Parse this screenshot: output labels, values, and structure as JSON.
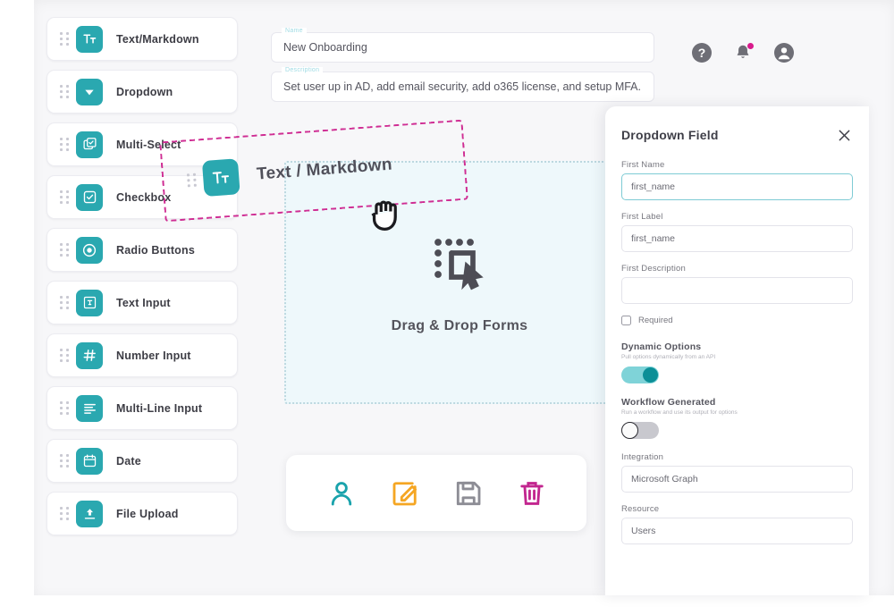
{
  "header": {
    "name_field": {
      "legend": "Name",
      "value": "New Onboarding"
    },
    "description_field": {
      "legend": "Description",
      "value": "Set user up in AD, add email security, add o365 license, and setup MFA."
    },
    "icons": [
      {
        "name": "help-icon",
        "label": "Help"
      },
      {
        "name": "notifications-bell-icon",
        "label": "Notifications"
      },
      {
        "name": "account-avatar-icon",
        "label": "Account"
      }
    ]
  },
  "palette": {
    "items": [
      {
        "label": "Text/Markdown",
        "icon": "text-markdown-icon"
      },
      {
        "label": "Dropdown",
        "icon": "dropdown-icon"
      },
      {
        "label": "Multi-Select",
        "icon": "multi-select-icon"
      },
      {
        "label": "Checkbox",
        "icon": "checkbox-icon"
      },
      {
        "label": "Radio Buttons",
        "icon": "radio-buttons-icon"
      },
      {
        "label": "Text Input",
        "icon": "text-input-icon"
      },
      {
        "label": "Number Input",
        "icon": "number-input-icon"
      },
      {
        "label": "Multi-Line Input",
        "icon": "multi-line-input-icon"
      },
      {
        "label": "Date",
        "icon": "date-icon"
      },
      {
        "label": "File Upload",
        "icon": "file-upload-icon"
      }
    ]
  },
  "canvas": {
    "dropzone_label": "Drag & Drop Forms",
    "dragging_item": {
      "label": "Text / Markdown",
      "icon": "text-markdown-icon"
    }
  },
  "actionbar": {
    "items": [
      {
        "name": "user-icon",
        "label": "User",
        "color": "#1aa3ac"
      },
      {
        "name": "edit-icon",
        "label": "Edit",
        "color": "#f5a623"
      },
      {
        "name": "save-icon",
        "label": "Save",
        "color": "#8d8d95"
      },
      {
        "name": "delete-icon",
        "label": "Delete",
        "color": "#c2268f"
      }
    ]
  },
  "properties": {
    "title": "Dropdown Field",
    "close_label": "Close",
    "fields": [
      {
        "label": "First Name",
        "value": "first_name",
        "focused": true
      },
      {
        "label": "First Label",
        "value": "first_name",
        "focused": false
      },
      {
        "label": "First Description",
        "value": "",
        "focused": false
      }
    ],
    "required": {
      "label": "Required",
      "checked": false
    },
    "toggles": [
      {
        "title": "Dynamic Options",
        "subtitle": "Pull options dynamically from an API",
        "state": "on"
      },
      {
        "title": "Workflow Generated",
        "subtitle": "Run a workflow and use its output for options",
        "state": "off"
      }
    ],
    "integration": {
      "label": "Integration",
      "value": "Microsoft Graph"
    },
    "resource": {
      "label": "Resource",
      "value": "Users"
    }
  },
  "colors": {
    "teal": "#2aa8b0",
    "magenta": "#cf2d93",
    "dropzone_bg": "#eef8fb",
    "app_bg": "#f7f7f9"
  }
}
